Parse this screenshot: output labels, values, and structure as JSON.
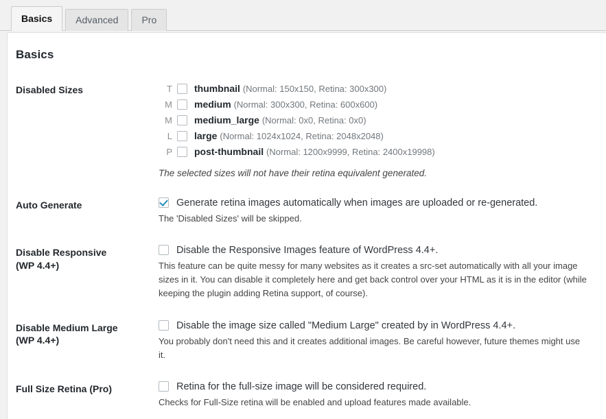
{
  "tabs": [
    {
      "label": "Basics",
      "active": true
    },
    {
      "label": "Advanced",
      "active": false
    },
    {
      "label": "Pro",
      "active": false
    }
  ],
  "panel": {
    "title": "Basics"
  },
  "rows": {
    "disabled_sizes": {
      "label": "Disabled Sizes",
      "note": "The selected sizes will not have their retina equivalent generated.",
      "sizes": [
        {
          "letter": "T",
          "name": "thumbnail",
          "dims": "(Normal: 150x150, Retina: 300x300)",
          "checked": false
        },
        {
          "letter": "M",
          "name": "medium",
          "dims": "(Normal: 300x300, Retina: 600x600)",
          "checked": false
        },
        {
          "letter": "M",
          "name": "medium_large",
          "dims": "(Normal: 0x0, Retina: 0x0)",
          "checked": false
        },
        {
          "letter": "L",
          "name": "large",
          "dims": "(Normal: 1024x1024, Retina: 2048x2048)",
          "checked": false
        },
        {
          "letter": "P",
          "name": "post-thumbnail",
          "dims": "(Normal: 1200x9999, Retina: 2400x19998)",
          "checked": false
        }
      ]
    },
    "auto_generate": {
      "label": "Auto Generate",
      "option": "Generate retina images automatically when images are uploaded or re-generated.",
      "desc": "The 'Disabled Sizes' will be skipped.",
      "checked": true
    },
    "disable_responsive": {
      "label": "Disable Responsive\n(WP 4.4+)",
      "label_line1": "Disable Responsive",
      "label_line2": "(WP 4.4+)",
      "option": "Disable the Responsive Images feature of WordPress 4.4+.",
      "desc": "This feature can be quite messy for many websites as it creates a src-set automatically with all your image sizes in it. You can disable it completely here and get back control over your HTML as it is in the editor (while keeping the plugin adding Retina support, of course).",
      "checked": false
    },
    "disable_medium_large": {
      "label_line1": "Disable Medium Large",
      "label_line2": "(WP 4.4+)",
      "option": "Disable the image size called \"Medium Large\" created by in WordPress 4.4+.",
      "desc": "You probably don't need this and it creates additional images. Be careful however, future themes might use it.",
      "checked": false
    },
    "full_size_retina": {
      "label": "Full Size Retina (Pro)",
      "option": "Retina for the full-size image will be considered required.",
      "desc": "Checks for Full-Size retina will be enabled and upload features made available.",
      "checked": false
    }
  },
  "colors": {
    "accent": "#1e8cbe",
    "page_bg": "#f1f1f1",
    "panel_bg": "#ffffff",
    "text": "#32373c",
    "muted": "#72777c"
  }
}
